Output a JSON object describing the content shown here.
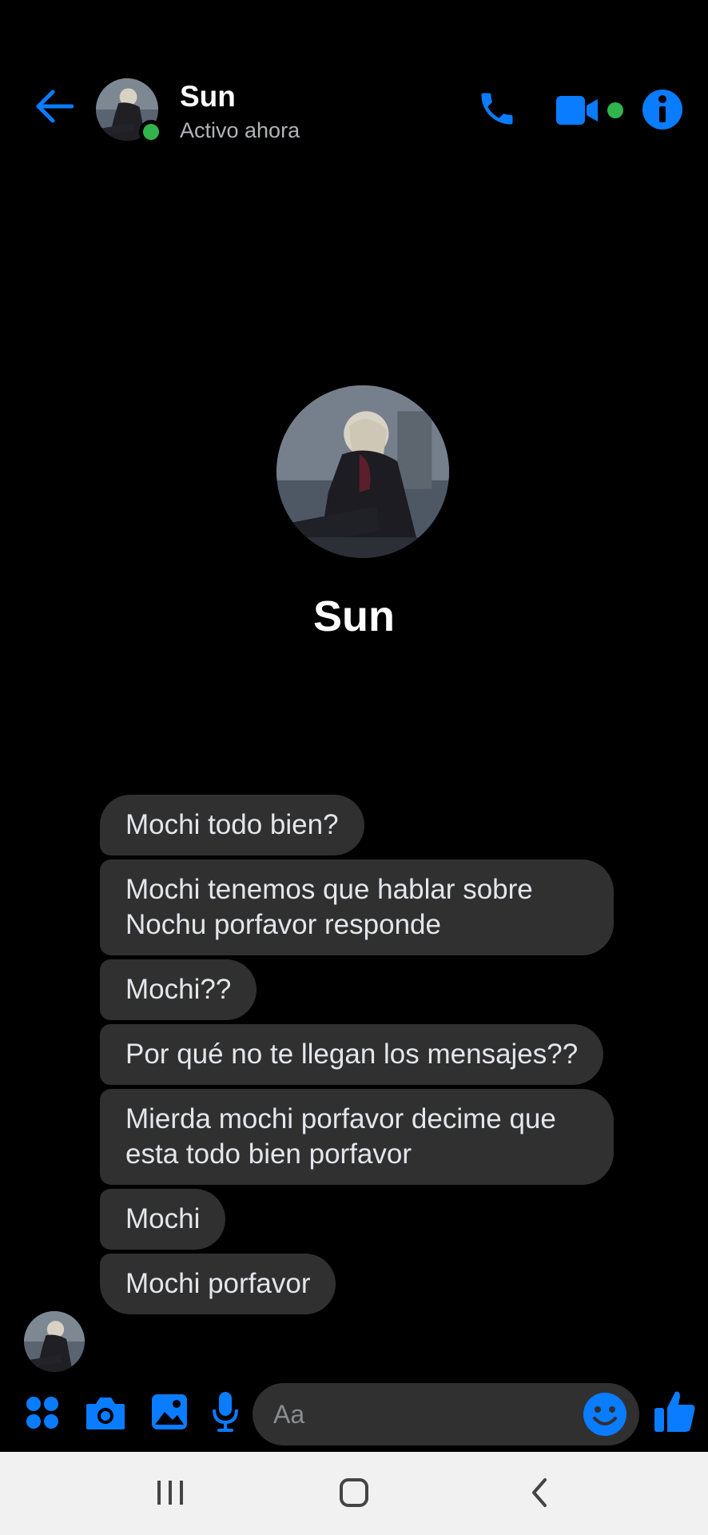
{
  "header": {
    "name": "Sun",
    "status": "Activo ahora"
  },
  "profile": {
    "name": "Sun"
  },
  "messages": [
    {
      "text": "Mochi todo bien?"
    },
    {
      "text": "Mochi tenemos que hablar sobre Nochu porfavor responde"
    },
    {
      "text": "Mochi??"
    },
    {
      "text": "Por qué no te llegan los mensajes??"
    },
    {
      "text": "Mierda mochi porfavor decime que esta todo bien porfavor"
    },
    {
      "text": "Mochi"
    },
    {
      "text": "Mochi porfavor"
    }
  ],
  "composer": {
    "placeholder": "Aa"
  },
  "icons": {
    "back": "arrow-left-icon",
    "call": "phone-icon",
    "video": "video-camera-icon",
    "info": "info-icon",
    "apps": "apps-grid-icon",
    "camera": "camera-icon",
    "gallery": "image-icon",
    "mic": "microphone-icon",
    "emoji": "smiley-icon",
    "like": "thumbs-up-icon",
    "recents": "recents-icon",
    "home": "home-icon",
    "nav_back": "chevron-left-icon"
  },
  "colors": {
    "accent": "#0a7cff",
    "online": "#31b44b",
    "bubble": "#303030",
    "background": "#000000"
  }
}
